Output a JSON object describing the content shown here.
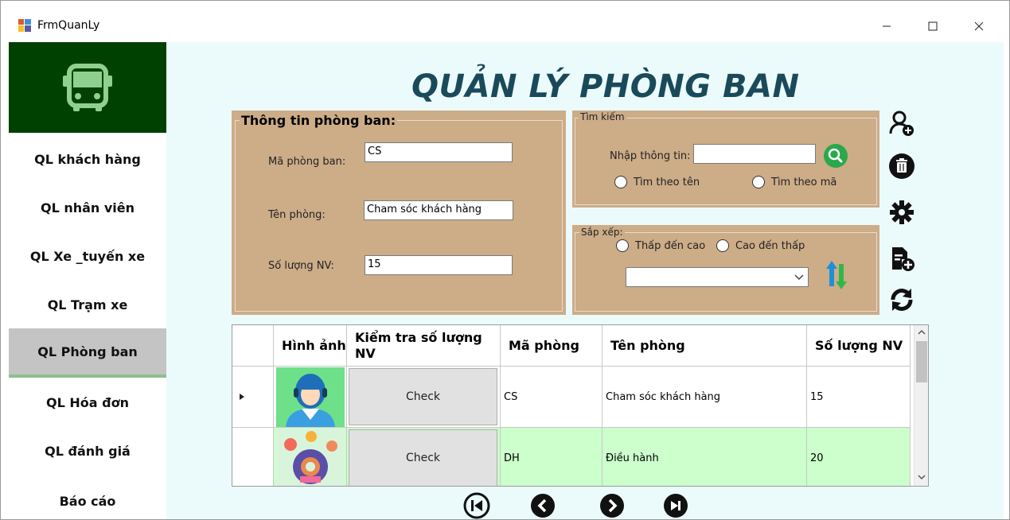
{
  "window": {
    "title": "FrmQuanLy"
  },
  "sidebar": {
    "logo_icon": "bus-icon",
    "items": [
      {
        "label": "QL khách hàng"
      },
      {
        "label": "QL nhân viên"
      },
      {
        "label": "QL Xe _tuyến xe"
      },
      {
        "label": "QL Trạm xe"
      },
      {
        "label": "QL Phòng ban",
        "active": true
      },
      {
        "label": "QL Hóa đơn"
      },
      {
        "label": "QL đánh giá"
      },
      {
        "label": "Báo cáo"
      }
    ]
  },
  "main": {
    "title": "QUẢN LÝ PHÒNG BAN",
    "info_group": {
      "legend": "Thông tin phòng ban:",
      "ma_label": "Mã phòng ban:",
      "ma_value": "CS",
      "ten_label": "Tên phòng:",
      "ten_value": "Cham sóc khách hàng",
      "soluong_label": "Số lượng NV:",
      "soluong_value": "15"
    },
    "search_group": {
      "legend": "Tìm kiếm",
      "input_label": "Nhập thông tin:",
      "input_value": "",
      "radio_name": "Tìm theo tên",
      "radio_code": "Tìm theo mã"
    },
    "sort_group": {
      "legend": "Sắp xếp:",
      "radio_asc": "Thấp đến cao",
      "radio_desc": "Cao đến thấp",
      "combo_value": ""
    },
    "grid": {
      "columns": [
        "",
        "Hình ảnh",
        "Kiểm tra số lượng NV",
        "Mã phòng",
        "Tên phòng",
        "Số lượng NV"
      ],
      "rows": [
        {
          "image": "support-agent-avatar",
          "check": "Check",
          "ma": "CS",
          "ten": "Cham sóc khách hàng",
          "soluong": "15"
        },
        {
          "image": "management-illustration",
          "check": "Check",
          "ma": "DH",
          "ten": "Điều hành",
          "soluong": "20"
        }
      ]
    },
    "colors": {
      "panel": "#cdac88",
      "sidebar_logo": "#004000",
      "content_bg": "#ebfbfb",
      "title": "#1a4a5a",
      "row_highlight": "#ccffcc"
    }
  }
}
